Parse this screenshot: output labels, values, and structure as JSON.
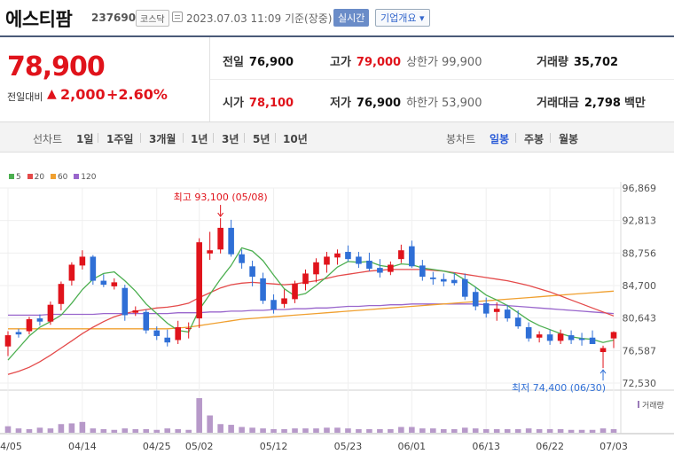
{
  "header": {
    "name": "에스티팜",
    "code": "237690",
    "market": "코스닥",
    "datetime": "2023.07.03 11:09",
    "basis": "기준(장중)",
    "live_btn": "실시간",
    "corp_btn": "기업개요 ▾"
  },
  "quote": {
    "price": "78,900",
    "change_label": "전일대비",
    "change": "2,000",
    "change_pct": "+2.60%",
    "prev_close": {
      "label": "전일",
      "value": "76,900"
    },
    "high": {
      "label": "고가",
      "value": "79,000",
      "sub_label": "상한가",
      "sub_value": "99,900"
    },
    "volume": {
      "label": "거래량",
      "value": "35,702"
    },
    "open": {
      "label": "시가",
      "value": "78,100"
    },
    "low": {
      "label": "저가",
      "value": "76,900",
      "sub_label": "하한가",
      "sub_value": "53,900"
    },
    "amount": {
      "label": "거래대금",
      "value": "2,798",
      "unit": "백만"
    }
  },
  "period_bar": {
    "line_label": "선차트",
    "line_periods": [
      "1일",
      "1주일",
      "3개월",
      "1년",
      "3년",
      "5년",
      "10년"
    ],
    "candle_label": "봉차트",
    "candle_periods": [
      "일봉",
      "주봉",
      "월봉"
    ],
    "active": "일봉"
  },
  "colors": {
    "up": "#e0131b",
    "down": "#2f6fd6",
    "ma5": "#4caf50",
    "ma20": "#e44a4a",
    "ma60": "#f0a030",
    "ma120": "#9966cc"
  },
  "chart_data": {
    "type": "candlestick",
    "legend": [
      "5",
      "20",
      "60",
      "120"
    ],
    "y_ticks": [
      "96,869",
      "92,813",
      "88,756",
      "84,700",
      "80,643",
      "76,587",
      "72,530"
    ],
    "ylim": [
      72530,
      96869
    ],
    "x_ticks": [
      "04/05",
      "04/14",
      "04/25",
      "05/02",
      "05/12",
      "05/23",
      "06/01",
      "06/13",
      "06/22",
      "07/03"
    ],
    "x_tick_index": [
      0,
      7,
      14,
      18,
      25,
      32,
      38,
      45,
      51,
      57
    ],
    "annotations": {
      "high": "최고 93,100 (05/08)",
      "high_index": 20,
      "high_value": 93100,
      "low": "최저 74,400 (06/30)",
      "low_index": 56,
      "low_value": 74400
    },
    "volume_label": "거래량",
    "candles": [
      [
        77100,
        79000,
        75900,
        78500
      ],
      [
        78900,
        79300,
        78200,
        78600
      ],
      [
        79000,
        80800,
        78600,
        80500
      ],
      [
        80600,
        81100,
        79700,
        80200
      ],
      [
        80200,
        82700,
        79800,
        82300
      ],
      [
        82400,
        85200,
        81600,
        84900
      ],
      [
        85300,
        87600,
        84700,
        87300
      ],
      [
        87200,
        89100,
        86700,
        88300
      ],
      [
        88300,
        88500,
        84800,
        85300
      ],
      [
        85300,
        86100,
        84500,
        84800
      ],
      [
        84600,
        85600,
        84200,
        85100
      ],
      [
        84400,
        84800,
        80300,
        81000
      ],
      [
        81300,
        82100,
        80900,
        81600
      ],
      [
        81400,
        81700,
        78700,
        79100
      ],
      [
        79100,
        79600,
        77900,
        78400
      ],
      [
        78200,
        79200,
        77100,
        77600
      ],
      [
        77900,
        80300,
        77400,
        79500
      ],
      [
        79300,
        80100,
        78100,
        79400
      ],
      [
        80600,
        90600,
        79400,
        90100
      ],
      [
        88700,
        91400,
        87900,
        89100
      ],
      [
        89200,
        93100,
        88700,
        91900
      ],
      [
        91900,
        92900,
        88300,
        88600
      ],
      [
        88600,
        89200,
        86800,
        87500
      ],
      [
        87100,
        87800,
        84600,
        85800
      ],
      [
        85600,
        86300,
        82400,
        82800
      ],
      [
        82900,
        83600,
        81200,
        81700
      ],
      [
        82400,
        84200,
        81900,
        83100
      ],
      [
        83000,
        85300,
        82500,
        84900
      ],
      [
        84900,
        86700,
        84100,
        86200
      ],
      [
        86100,
        88100,
        85100,
        87600
      ],
      [
        87300,
        88900,
        86300,
        88300
      ],
      [
        88200,
        89200,
        87300,
        88700
      ],
      [
        88900,
        89700,
        87700,
        88000
      ],
      [
        88300,
        88900,
        86900,
        87400
      ],
      [
        87800,
        88800,
        86500,
        86800
      ],
      [
        86900,
        88000,
        85700,
        86300
      ],
      [
        86400,
        87700,
        86000,
        87300
      ],
      [
        88000,
        89800,
        87500,
        89100
      ],
      [
        89600,
        90300,
        86900,
        87100
      ],
      [
        87200,
        87900,
        85300,
        85800
      ],
      [
        85700,
        86400,
        84800,
        85500
      ],
      [
        85500,
        86200,
        84600,
        85200
      ],
      [
        85400,
        86300,
        84700,
        85000
      ],
      [
        85500,
        86200,
        82900,
        83300
      ],
      [
        83900,
        84500,
        81600,
        82100
      ],
      [
        82500,
        83200,
        80700,
        81200
      ],
      [
        81400,
        82600,
        80300,
        81800
      ],
      [
        81700,
        82300,
        80200,
        80600
      ],
      [
        80700,
        81600,
        79300,
        79600
      ],
      [
        79500,
        80100,
        77700,
        78100
      ],
      [
        78200,
        79000,
        77600,
        78600
      ],
      [
        78600,
        79200,
        77300,
        77800
      ],
      [
        77800,
        79200,
        77400,
        78700
      ],
      [
        78500,
        79100,
        77400,
        77900
      ],
      [
        78100,
        78800,
        77200,
        77900
      ],
      [
        78200,
        79100,
        77500,
        77400
      ],
      [
        76400,
        77200,
        74400,
        76900
      ],
      [
        78100,
        79000,
        76900,
        78900
      ]
    ],
    "ma5": [
      75400,
      76900,
      78400,
      79500,
      80200,
      81000,
      82500,
      84200,
      85500,
      86200,
      86400,
      85300,
      84000,
      82400,
      81200,
      80000,
      79100,
      78900,
      81700,
      83600,
      85500,
      87200,
      89400,
      89000,
      87800,
      86000,
      84300,
      83400,
      83700,
      84700,
      85800,
      87000,
      87700,
      87600,
      87700,
      87200,
      87000,
      87400,
      87300,
      86900,
      86700,
      86500,
      86200,
      85400,
      84500,
      83500,
      82900,
      82200,
      81300,
      80400,
      79700,
      79200,
      78700,
      78300,
      78100,
      78000,
      77600,
      77900
    ],
    "ma20": [
      73600,
      74000,
      74500,
      75200,
      76000,
      76900,
      77800,
      78700,
      79500,
      80200,
      80800,
      81200,
      81500,
      81700,
      81900,
      82000,
      82200,
      82500,
      83200,
      83800,
      84400,
      84800,
      85000,
      85100,
      85000,
      84900,
      84800,
      84900,
      85100,
      85300,
      85600,
      85900,
      86100,
      86300,
      86500,
      86600,
      86700,
      86700,
      86700,
      86700,
      86600,
      86500,
      86300,
      86100,
      85900,
      85700,
      85500,
      85300,
      85000,
      84700,
      84300,
      83900,
      83400,
      82900,
      82400,
      81900,
      81400,
      80900
    ],
    "ma60": [
      79300,
      79300,
      79300,
      79300,
      79300,
      79300,
      79300,
      79300,
      79300,
      79300,
      79300,
      79300,
      79300,
      79300,
      79300,
      79300,
      79400,
      79500,
      79700,
      79900,
      80100,
      80300,
      80500,
      80600,
      80700,
      80800,
      80900,
      81000,
      81100,
      81200,
      81300,
      81400,
      81500,
      81600,
      81700,
      81800,
      81900,
      82000,
      82100,
      82200,
      82300,
      82400,
      82500,
      82600,
      82700,
      82800,
      82900,
      83000,
      83100,
      83200,
      83300,
      83400,
      83500,
      83600,
      83700,
      83800,
      83900,
      84000
    ],
    "ma120": [
      81000,
      81000,
      81000,
      81000,
      81100,
      81100,
      81100,
      81100,
      81100,
      81200,
      81200,
      81200,
      81200,
      81200,
      81200,
      81200,
      81300,
      81300,
      81300,
      81400,
      81400,
      81500,
      81500,
      81600,
      81600,
      81700,
      81700,
      81800,
      81800,
      81900,
      81900,
      82000,
      82100,
      82100,
      82200,
      82200,
      82300,
      82300,
      82400,
      82400,
      82400,
      82400,
      82400,
      82400,
      82400,
      82300,
      82300,
      82200,
      82100,
      82000,
      81900,
      81800,
      81700,
      81600,
      81500,
      81400,
      81300,
      81200
    ],
    "volume": [
      9,
      6,
      5,
      7,
      6,
      12,
      13,
      15,
      6,
      5,
      4,
      6,
      5,
      5,
      4,
      6,
      5,
      4,
      48,
      24,
      12,
      11,
      8,
      7,
      6,
      5,
      5,
      6,
      6,
      6,
      7,
      7,
      6,
      5,
      5,
      5,
      5,
      8,
      8,
      6,
      6,
      5,
      5,
      7,
      6,
      5,
      5,
      5,
      5,
      6,
      5,
      5,
      5,
      4,
      4,
      4,
      6,
      5
    ]
  }
}
